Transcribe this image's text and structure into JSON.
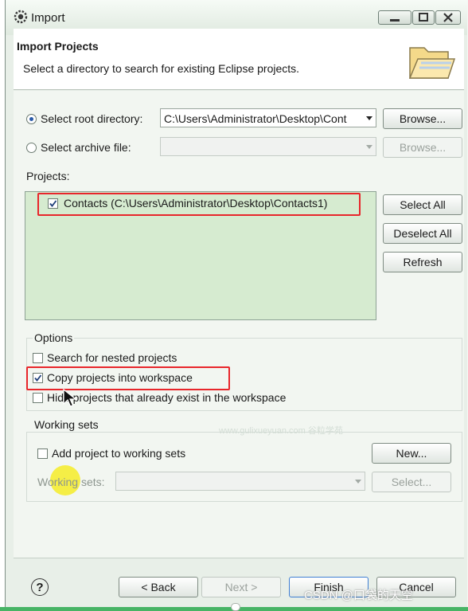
{
  "window": {
    "title": "Import"
  },
  "header": {
    "title": "Import Projects",
    "description": "Select a directory to search for existing Eclipse projects."
  },
  "source": {
    "root_directory_label": "Select root directory:",
    "root_directory_value": "C:\\Users\\Administrator\\Desktop\\Cont",
    "root_directory_selected": true,
    "archive_file_label": "Select archive file:",
    "archive_file_value": "",
    "browse_label": "Browse...",
    "browse_label_archive": "Browse..."
  },
  "projects": {
    "label": "Projects:",
    "items": [
      {
        "label": "Contacts (C:\\Users\\Administrator\\Desktop\\Contacts1)",
        "checked": true
      }
    ],
    "select_all": "Select All",
    "deselect_all": "Deselect All",
    "refresh": "Refresh"
  },
  "options": {
    "label": "Options",
    "search_nested": {
      "label": "Search for nested projects",
      "checked": false
    },
    "copy_projects": {
      "label": "Copy projects into workspace",
      "checked": true
    },
    "hide_existing": {
      "label": "Hide projects that already exist in the workspace",
      "checked": false
    }
  },
  "working_sets": {
    "label": "Working sets",
    "add_label": "Add project to working sets",
    "add_checked": false,
    "new_button": "New...",
    "sets_label": "Working sets:",
    "sets_value": "",
    "select_button": "Select..."
  },
  "footer": {
    "help": "?",
    "back": "< Back",
    "next": "Next >",
    "finish": "Finish",
    "cancel": "Cancel"
  },
  "overlays": {
    "watermark": "www.gulixueyuan.com 谷粒学苑",
    "csdn": "CSDN @口袋的天空"
  },
  "colors": {
    "accent_blue": "#2a5aa8",
    "highlight_red": "#e8262b",
    "projects_bg": "#d6ebd0",
    "cursor_yellow": "#f6ec28"
  }
}
